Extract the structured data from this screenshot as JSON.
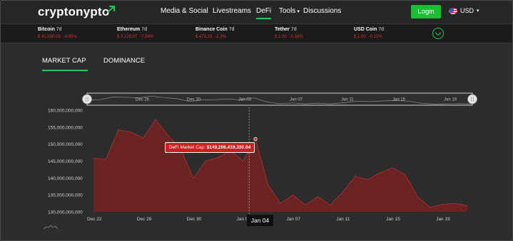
{
  "nav": {
    "logo_part1": "crypto",
    "logo_part2": "nypto",
    "links": [
      {
        "label": "Media & Social",
        "active": false
      },
      {
        "label": "Livestreams",
        "active": false
      },
      {
        "label": "DeFi",
        "active": true
      },
      {
        "label": "Tools",
        "active": false
      },
      {
        "label": "Discussions",
        "active": false
      }
    ],
    "login_label": "Login",
    "currency": "USD"
  },
  "ticker": [
    {
      "name": "Bitcoin",
      "period": "7d",
      "price": "$ 41,030.03",
      "change": "-4.65%"
    },
    {
      "name": "Ethereum",
      "period": "7d",
      "price": "$ 3,129.97",
      "change": "-7.54%"
    },
    {
      "name": "Binance Coin",
      "period": "7d",
      "price": "$ 473.15",
      "change": "-2.3%"
    },
    {
      "name": "Tether",
      "period": "7d",
      "price": "$ 1.00",
      "change": "-0.18%"
    },
    {
      "name": "USD Coin",
      "period": "7d",
      "price": "$ 1.00",
      "change": "-0.15%"
    }
  ],
  "tabs": [
    {
      "label": "MARKET CAP",
      "active": true
    },
    {
      "label": "DOMINANCE",
      "active": false
    }
  ],
  "tooltip": {
    "label": "DeFi Market Cap:",
    "value": "$149,206,419,330.04"
  },
  "crosshair_label": "Jan 04",
  "colors": {
    "accent": "#22c55e",
    "area_fill": "#6b2322",
    "area_line": "#8f2f2c",
    "negative": "#d0312d"
  },
  "chart_data": {
    "type": "area",
    "title": "",
    "xlabel": "",
    "ylabel": "",
    "ylim": [
      130000000000,
      160000000000
    ],
    "ytick_labels": [
      "160,000,000,000",
      "155,000,000,000",
      "150,000,000,000",
      "145,000,000,000",
      "140,000,000,000",
      "135,000,000,000",
      "130,000,000,000"
    ],
    "ytick_values": [
      160000000000,
      155000000000,
      150000000000,
      145000000000,
      140000000000,
      135000000000,
      130000000000
    ],
    "xtick_labels": [
      "Dec 22",
      "Dec 26",
      "Dec 30",
      "Jan 03",
      "Jan 07",
      "Jan 11",
      "Jan 15",
      "Jan 19"
    ],
    "xtick_days": [
      0,
      4,
      8,
      12,
      16,
      20,
      24,
      28
    ],
    "navigator_tick_labels": [
      "Dec 26",
      "Dec 30",
      "Jan 03",
      "Jan 07",
      "Jan 11",
      "Jan 15",
      "Jan 19"
    ],
    "navigator_tick_days": [
      4,
      8,
      12,
      16,
      20,
      24,
      28
    ],
    "x_labels": [
      "Dec 22",
      "",
      "",
      "",
      "",
      "",
      "",
      "",
      "Dec 30",
      "",
      "",
      "",
      "Jan 03",
      "Jan 04",
      "",
      "",
      "",
      "",
      "",
      "",
      "",
      "",
      "",
      "",
      "",
      "",
      "",
      "",
      "Jan 19",
      "",
      ""
    ],
    "series": [
      {
        "values": [
          145800000000,
          145500000000,
          154200000000,
          153500000000,
          151800000000,
          157200000000,
          152400000000,
          148600000000,
          139900000000,
          145000000000,
          146000000000,
          148000000000,
          145000000000,
          151500000000,
          138000000000,
          132500000000,
          135000000000,
          132000000000,
          134500000000,
          132000000000,
          135800000000,
          140500000000,
          139500000000,
          141500000000,
          143000000000,
          141000000000,
          134500000000,
          131300000000,
          132200000000,
          132500000000,
          131800000000
        ]
      }
    ],
    "grid": false,
    "legend": "none"
  }
}
